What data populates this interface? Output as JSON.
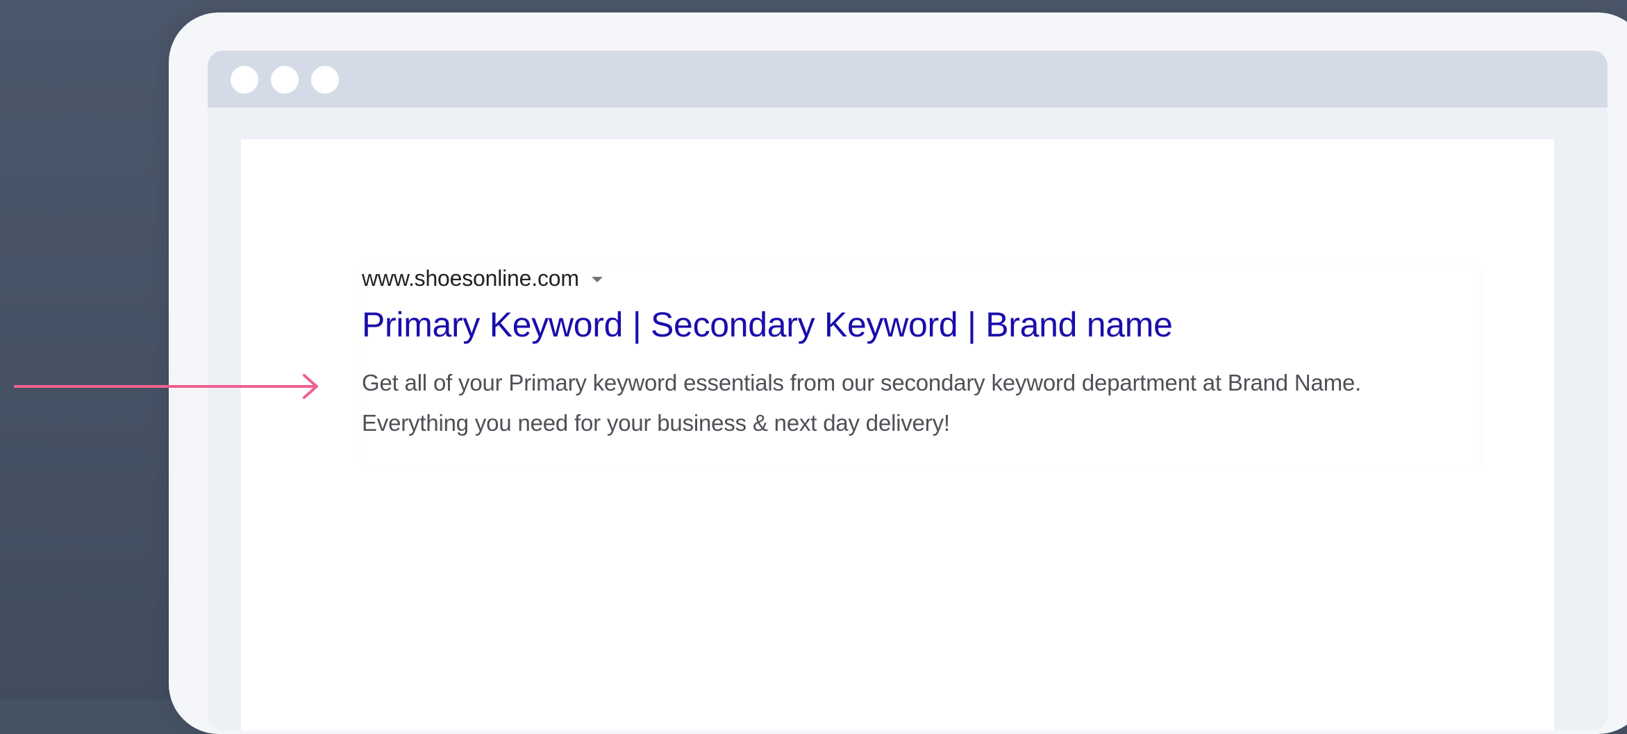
{
  "browser": {
    "window_controls": [
      "dot",
      "dot",
      "dot"
    ]
  },
  "search_result": {
    "url": "www.shoesonline.com",
    "title": "Primary Keyword | Secondary Keyword | Brand name",
    "description": "Get all of your Primary keyword essentials from our secondary keyword department at Brand Name. Everything you need for your business & next day delivery!"
  },
  "colors": {
    "background": "#455264",
    "title_link": "#1a0dab",
    "snippet": "#4d5156",
    "arrow": "#f0608f"
  },
  "icons": {
    "url_dropdown": "caret-down-icon",
    "pointer": "arrow-right-icon"
  }
}
